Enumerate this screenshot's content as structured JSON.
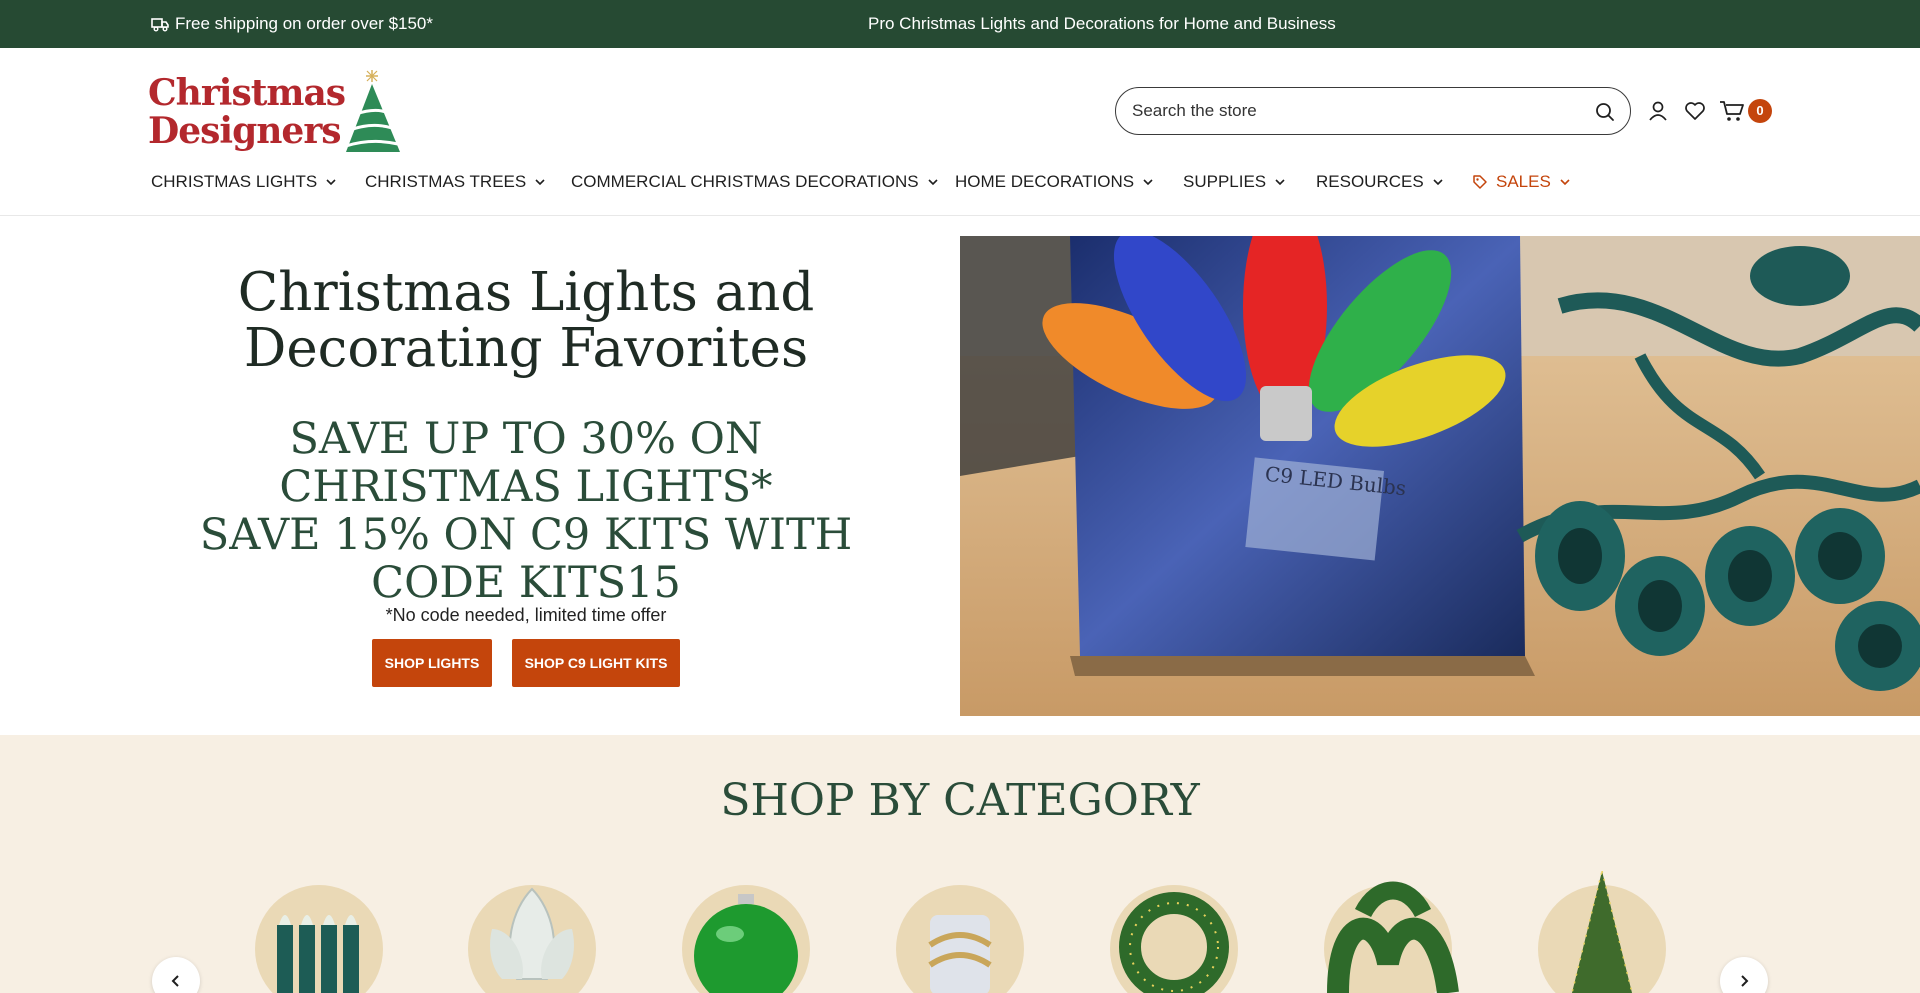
{
  "announcement": {
    "shipping": "Free shipping on order over $150*",
    "tagline": "Pro Christmas Lights and Decorations for Home and Business"
  },
  "logo": {
    "line1": "Christmas",
    "line2": "Designers"
  },
  "search": {
    "placeholder": "Search the store"
  },
  "cart": {
    "count": "0"
  },
  "nav": [
    {
      "label": "CHRISTMAS LIGHTS"
    },
    {
      "label": "CHRISTMAS TREES"
    },
    {
      "label": "COMMERCIAL CHRISTMAS DECORATIONS"
    },
    {
      "label": "HOME DECORATIONS"
    },
    {
      "label": "SUPPLIES"
    },
    {
      "label": "RESOURCES"
    },
    {
      "label": "SALES"
    }
  ],
  "hero": {
    "title_line1": "Christmas Lights and",
    "title_line2": "Decorating Favorites",
    "promo_line1": "SAVE UP TO 30% ON",
    "promo_line2": "CHRISTMAS LIGHTS*",
    "promo_line3": "SAVE 15% ON C9 KITS WITH",
    "promo_line4": "CODE KITS15",
    "note": "*No code needed, limited time offer",
    "button1": "SHOP LIGHTS",
    "button2": "SHOP C9 LIGHT KITS",
    "image_box_label": "C9 LED Bulbs"
  },
  "categories": {
    "title": "SHOP BY CATEGORY"
  },
  "colors": {
    "announcement_bg": "#264a33",
    "accent": "#c4450c",
    "heading_green": "#2a4c39",
    "category_bg": "#f7efe3"
  }
}
